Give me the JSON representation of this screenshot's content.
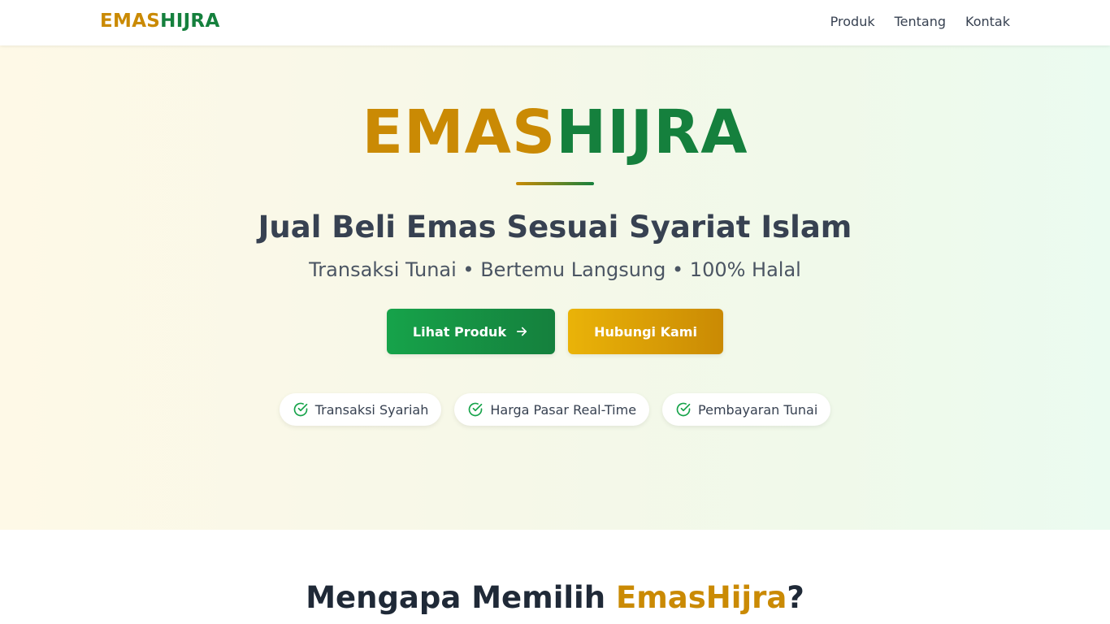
{
  "nav": {
    "logo_part1": "EMAS",
    "logo_part2": "HIJRA",
    "links": [
      "Produk",
      "Tentang",
      "Kontak"
    ]
  },
  "hero": {
    "title_part1": "EMAS",
    "title_part2": "HIJRA",
    "heading": "Jual Beli Emas Sesuai Syariat Islam",
    "subheading": "Transaksi Tunai • Bertemu Langsung • 100% Halal",
    "primary_button": "Lihat Produk",
    "secondary_button": "Hubungi Kami",
    "badges": [
      "Transaksi Syariah",
      "Harga Pasar Real-Time",
      "Pembayaran Tunai"
    ]
  },
  "why": {
    "title_prefix": "Mengapa Memilih ",
    "title_brand": "EmasHijra",
    "title_suffix": "?"
  },
  "colors": {
    "gold": "#ca8a04",
    "green": "#15803d",
    "primary_button": "#16a34a",
    "secondary_button": "#eab308"
  },
  "icons": [
    "arrow-right-icon",
    "check-circle-icon"
  ]
}
